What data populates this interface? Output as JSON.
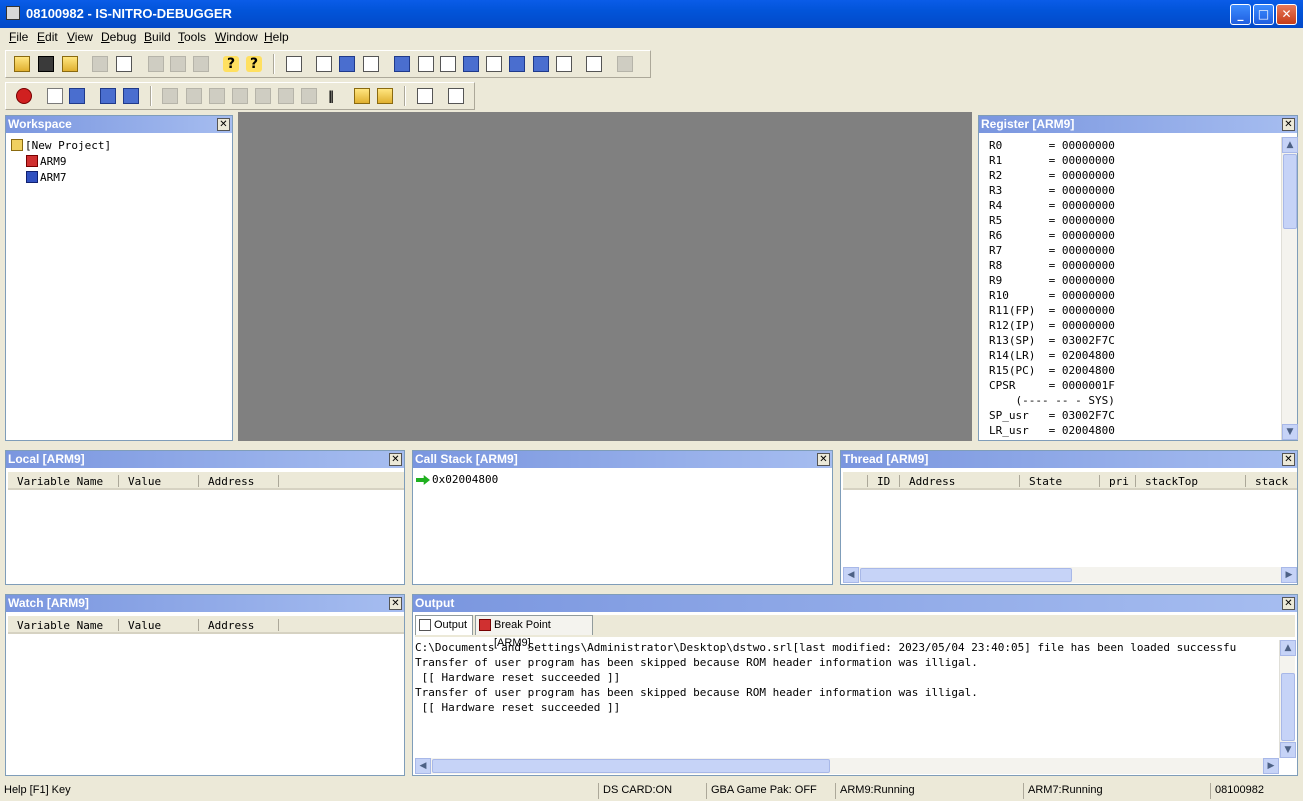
{
  "window": {
    "title": "08100982 - IS-NITRO-DEBUGGER",
    "min": "_",
    "max": "□",
    "close": "✕"
  },
  "menu": [
    "File",
    "Edit",
    "View",
    "Debug",
    "Build",
    "Tools",
    "Window",
    "Help"
  ],
  "workspace": {
    "title": "Workspace",
    "close": "✕",
    "items": [
      "[New Project]",
      "ARM9",
      "ARM7"
    ]
  },
  "register": {
    "title": "Register [ARM9]",
    "close": "✕",
    "rows": [
      "R0       = 00000000",
      "R1       = 00000000",
      "R2       = 00000000",
      "R3       = 00000000",
      "R4       = 00000000",
      "R5       = 00000000",
      "R6       = 00000000",
      "R7       = 00000000",
      "R8       = 00000000",
      "R9       = 00000000",
      "R10      = 00000000",
      "R11(FP)  = 00000000",
      "R12(IP)  = 00000000",
      "R13(SP)  = 03002F7C",
      "R14(LR)  = 02004800",
      "R15(PC)  = 02004800",
      "CPSR     = 0000001F",
      "    (---- -- - SYS)",
      "SP_usr   = 03002F7C",
      "LR_usr   = 02004800"
    ]
  },
  "local": {
    "title": "Local [ARM9]",
    "close": "✕",
    "columns": [
      "Variable Name",
      "Value",
      "Address"
    ]
  },
  "callstack": {
    "title": "Call Stack [ARM9]",
    "close": "✕",
    "entries": [
      "0x02004800"
    ]
  },
  "thread": {
    "title": "Thread [ARM9]",
    "close": "✕",
    "columns": [
      "ID",
      "Address",
      "State",
      "pri",
      "stackTop",
      "stack"
    ]
  },
  "watch": {
    "title": "Watch [ARM9]",
    "close": "✕",
    "columns": [
      "Variable Name",
      "Value",
      "Address"
    ]
  },
  "output": {
    "title": "Output",
    "close": "✕",
    "tabs": [
      "Output",
      "Break Point [ARM9]"
    ],
    "lines": [
      "C:\\Documents and Settings\\Administrator\\Desktop\\dstwo.srl[last modified: 2023/05/04 23:40:05] file has been loaded successfu",
      "Transfer of user program has been skipped because ROM header information was illigal.",
      " [[ Hardware reset succeeded ]]",
      "Transfer of user program has been skipped because ROM header information was illigal.",
      " [[ Hardware reset succeeded ]]"
    ]
  },
  "status": {
    "help": "Help [F1] Key",
    "ds_card": "DS CARD:ON",
    "gba": "GBA Game Pak: OFF",
    "arm9": "ARM9:Running",
    "arm7": "ARM7:Running",
    "id": "08100982"
  },
  "icons": {
    "toolbar1": [
      "open-folder-icon",
      "save-icon",
      "save-all-icon",
      "connect-icon",
      "disconnect-icon",
      "cut-icon",
      "copy-icon",
      "paste-icon",
      "help-icon",
      "context-help-icon",
      "source-icon",
      "disassembly-icon",
      "memory-icon",
      "register-icon",
      "call-stack-icon",
      "local-icon",
      "watch-icon",
      "thread-icon",
      "breakpoint-list-icon",
      "io-register-icon",
      "map-icon",
      "output-icon",
      "view-icon"
    ],
    "toolbar2": [
      "stop-icon",
      "reset-icon",
      "load-icon",
      "run-icon",
      "run-to-icon",
      "step-into-icon",
      "step-over-icon",
      "step-out-icon",
      "step-icon",
      "step-line-icon",
      "step-asm-icon",
      "pause-icon",
      "break-icon",
      "break-all-icon",
      "edit-icon",
      "window-icon"
    ]
  }
}
